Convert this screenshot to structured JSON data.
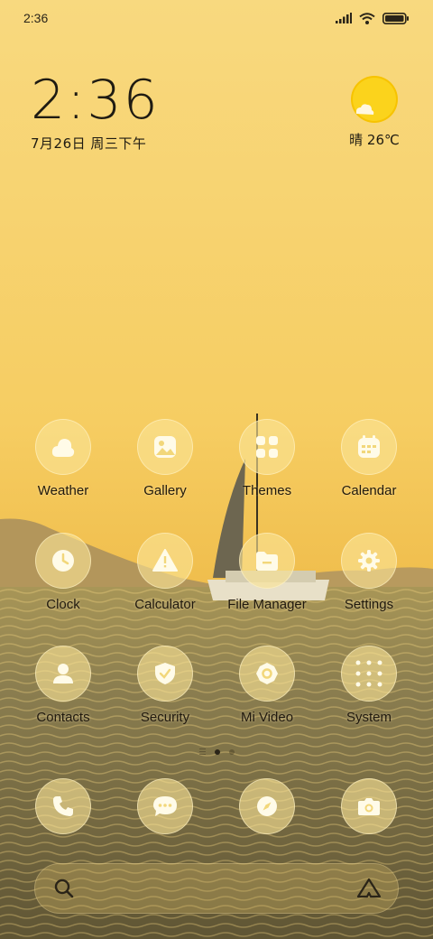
{
  "status_bar": {
    "time": "2:36",
    "icons": [
      "signal-icon",
      "wifi-icon",
      "battery-icon"
    ]
  },
  "clock_widget": {
    "time": "2:36",
    "date": "7月26日 周三下午"
  },
  "weather_widget": {
    "icon": "sun-cloud-icon",
    "text": "晴 26℃"
  },
  "apps": [
    {
      "label": "Weather",
      "icon": "weather-icon"
    },
    {
      "label": "Gallery",
      "icon": "gallery-icon"
    },
    {
      "label": "Themes",
      "icon": "themes-icon"
    },
    {
      "label": "Calendar",
      "icon": "calendar-icon"
    },
    {
      "label": "Clock",
      "icon": "clock-icon"
    },
    {
      "label": "Calculator",
      "icon": "calculator-icon"
    },
    {
      "label": "File Manager",
      "icon": "folder-icon"
    },
    {
      "label": "Settings",
      "icon": "gear-icon"
    },
    {
      "label": "Contacts",
      "icon": "contacts-icon"
    },
    {
      "label": "Security",
      "icon": "shield-icon"
    },
    {
      "label": "Mi Video",
      "icon": "video-icon"
    },
    {
      "label": "System",
      "icon": "system-folder-icon"
    }
  ],
  "page_indicator": {
    "pages": 2,
    "current": 1
  },
  "dock": [
    {
      "icon": "phone-icon"
    },
    {
      "icon": "message-icon"
    },
    {
      "icon": "browser-icon"
    },
    {
      "icon": "camera-icon"
    }
  ],
  "search_bar": {
    "left_icon": "search-icon",
    "right_icon": "assistant-icon"
  },
  "colors": {
    "accent": "#f5c95d",
    "icon_glyph": "#fffbe8",
    "text": "#20190e"
  }
}
